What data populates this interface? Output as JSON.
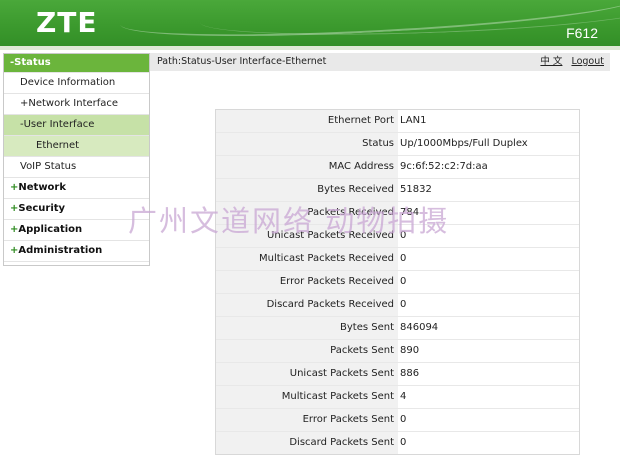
{
  "header": {
    "logo": "ZTE",
    "model": "F612"
  },
  "path": {
    "text": "Path:Status-User Interface-Ethernet",
    "lang_label": "中 文",
    "logout_label": "Logout"
  },
  "sidebar": {
    "status": "-Status",
    "device_information": "Device Information",
    "network_interface": "+Network Interface",
    "user_interface": "-User Interface",
    "ethernet": "Ethernet",
    "voip_status": "VoIP Status",
    "network": "Network",
    "security": "Security",
    "application": "Application",
    "administration": "Administration",
    "plus": "+"
  },
  "ethernet": [
    {
      "label": "Ethernet Port",
      "value": "LAN1"
    },
    {
      "label": "Status",
      "value": "Up/1000Mbps/Full Duplex"
    },
    {
      "label": "MAC Address",
      "value": "9c:6f:52:c2:7d:aa"
    },
    {
      "label": "Bytes Received",
      "value": "51832"
    },
    {
      "label": "Packets Received",
      "value": "784"
    },
    {
      "label": "Unicast Packets Received",
      "value": "0"
    },
    {
      "label": "Multicast Packets Received",
      "value": "0"
    },
    {
      "label": "Error Packets Received",
      "value": "0"
    },
    {
      "label": "Discard Packets Received",
      "value": "0"
    },
    {
      "label": "Bytes Sent",
      "value": "846094"
    },
    {
      "label": "Packets Sent",
      "value": "890"
    },
    {
      "label": "Unicast Packets Sent",
      "value": "886"
    },
    {
      "label": "Multicast Packets Sent",
      "value": "4"
    },
    {
      "label": "Error Packets Sent",
      "value": "0"
    },
    {
      "label": "Discard Packets Sent",
      "value": "0"
    }
  ],
  "watermark": "广州文道网络 动物拍摄"
}
